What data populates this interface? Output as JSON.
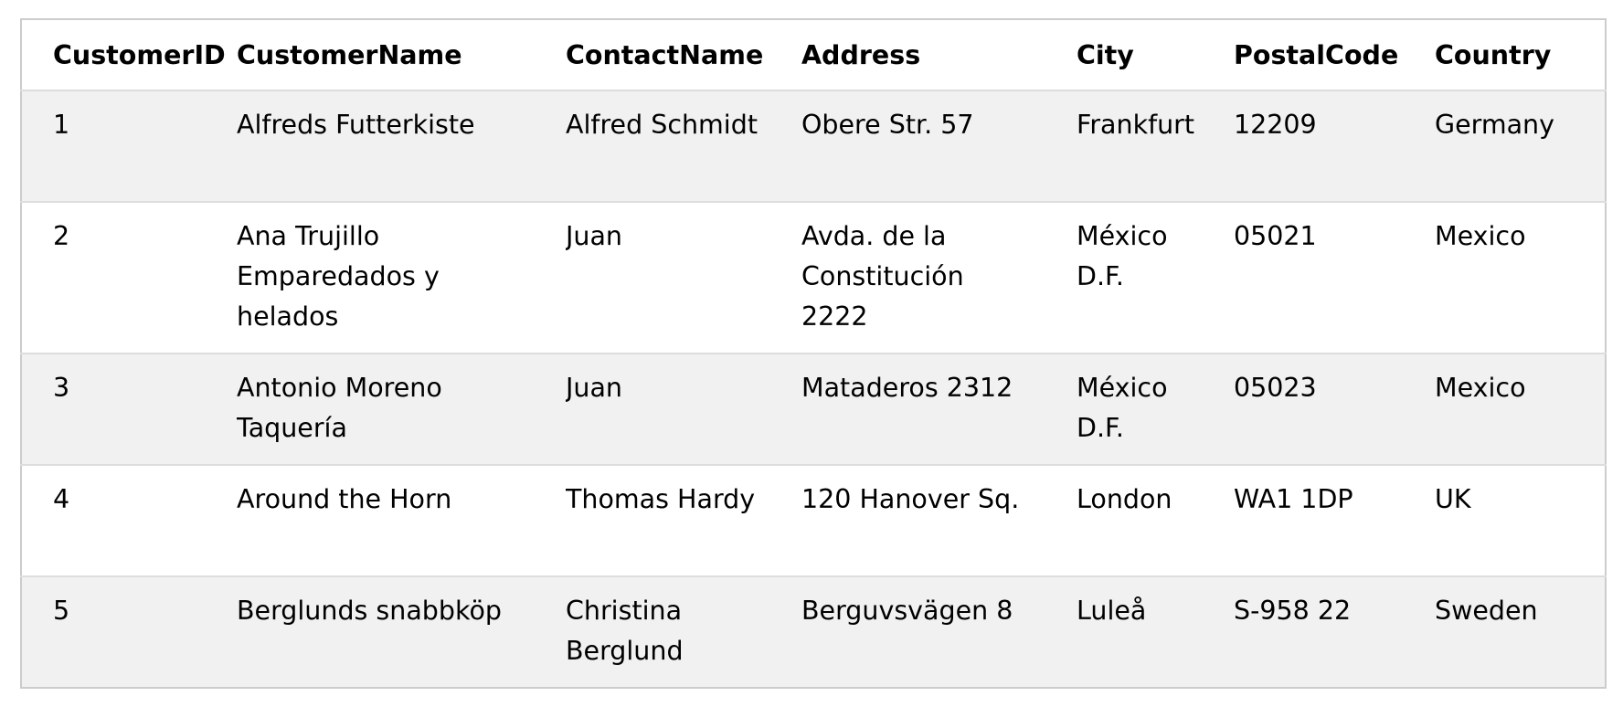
{
  "table": {
    "headers": [
      "CustomerID",
      "CustomerName",
      "ContactName",
      "Address",
      "City",
      "PostalCode",
      "Country"
    ],
    "rows": [
      [
        "1",
        "Alfreds Futterkiste",
        "Alfred Schmidt",
        "Obere Str. 57",
        "Frankfurt",
        "12209",
        "Germany"
      ],
      [
        "2",
        "Ana Trujillo Emparedados y helados",
        "Juan",
        "Avda. de la Constitución 2222",
        "México D.F.",
        "05021",
        "Mexico"
      ],
      [
        "3",
        "Antonio Moreno Taquería",
        "Juan",
        "Mataderos 2312",
        "México D.F.",
        "05023",
        "Mexico"
      ],
      [
        "4",
        "Around the Horn",
        "Thomas Hardy",
        "120 Hanover Sq.",
        "London",
        "WA1 1DP",
        "UK"
      ],
      [
        "5",
        "Berglunds snabbköp",
        "Christina Berglund",
        "Berguvsvägen 8",
        "Luleå",
        "S-958 22",
        "Sweden"
      ]
    ]
  },
  "colors": {
    "border": "#cccccc",
    "row_divider": "#dddddd",
    "stripe": "#f1f1f1",
    "background": "#ffffff"
  }
}
